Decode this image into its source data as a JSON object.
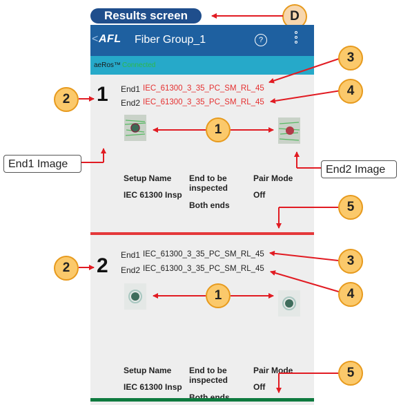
{
  "tag": {
    "results_screen": "Results screen",
    "callout_d": "D"
  },
  "header": {
    "back_icon": "<",
    "logo": "AFL",
    "title": "Fiber Group_1",
    "help_icon": "?",
    "menu_icon": "kebab-menu"
  },
  "status_bar": {
    "brand": "aeRos™",
    "connection": "Connected",
    "connection_color": "#2db84a"
  },
  "records": [
    {
      "number": "1",
      "end1_label": "End1",
      "end1_value": "IEC_61300_3_35_PC_SM_RL_45",
      "end2_label": "End2",
      "end2_value": "IEC_61300_3_35_PC_SM_RL_45",
      "value_color": "#e53030",
      "setup_name_label": "Setup Name",
      "setup_name_value": "IEC 61300 Insp",
      "end_label": "End to be inspected",
      "end_value": "Both ends",
      "pair_mode_label": "Pair Mode",
      "pair_mode_value": "Off",
      "separator_color": "#e4383a"
    },
    {
      "number": "2",
      "end1_label": "End1",
      "end1_value": "IEC_61300_3_35_PC_SM_RL_45",
      "end2_label": "End2",
      "end2_value": "IEC_61300_3_35_PC_SM_RL_45",
      "value_color": "#222222",
      "setup_name_label": "Setup Name",
      "setup_name_value": "IEC 61300 Insp",
      "end_label": "End to be inspected",
      "end_value": "Both ends",
      "pair_mode_label": "Pair Mode",
      "pair_mode_value": "Off",
      "separator_color": "#0e7a3f"
    }
  ],
  "annotations": {
    "end1_image": "End1 Image",
    "end2_image": "End2 Image",
    "callouts": [
      "1",
      "2",
      "3",
      "4",
      "5"
    ]
  }
}
